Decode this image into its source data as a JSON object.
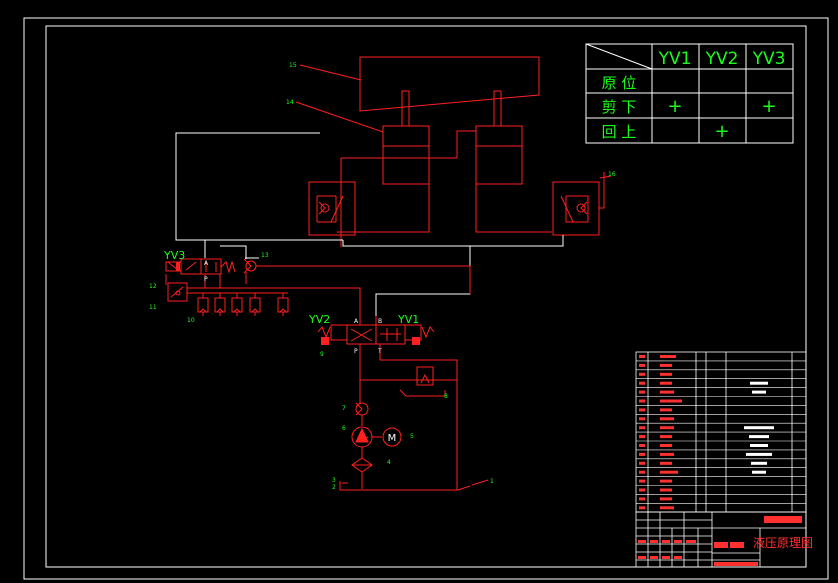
{
  "truth_table": {
    "headers": [
      "YV1",
      "YV2",
      "YV3"
    ],
    "rows": [
      {
        "label": "原 位",
        "cells": [
          "",
          "",
          ""
        ]
      },
      {
        "label": "剪 下",
        "cells": [
          "+",
          "",
          "+"
        ]
      },
      {
        "label": "回 上",
        "cells": [
          "",
          "+",
          ""
        ]
      }
    ]
  },
  "valve_labels": {
    "yv3": "YV3",
    "yv2": "YV2",
    "yv1": "YV1"
  },
  "port_labels": {
    "A": "A",
    "B": "B",
    "P": "P",
    "T": "T"
  },
  "callouts": {
    "n1": "1",
    "n2": "2",
    "n3": "3",
    "n4": "4",
    "n5": "5",
    "n6": "6",
    "n7": "7",
    "n8": "8",
    "n9": "9",
    "n10": "10",
    "n11": "11",
    "n12": "12",
    "n13": "13",
    "n14": "14",
    "n15": "15",
    "n16": "16"
  },
  "motor_symbol": "M",
  "title_block": {
    "drawing_title": "液压原理图"
  },
  "colors": {
    "background": "#000000",
    "frame": "#ffffff",
    "hydraulic_lines": "#ff2020",
    "labels": "#19ff19",
    "pipe_white": "#ffffff"
  }
}
